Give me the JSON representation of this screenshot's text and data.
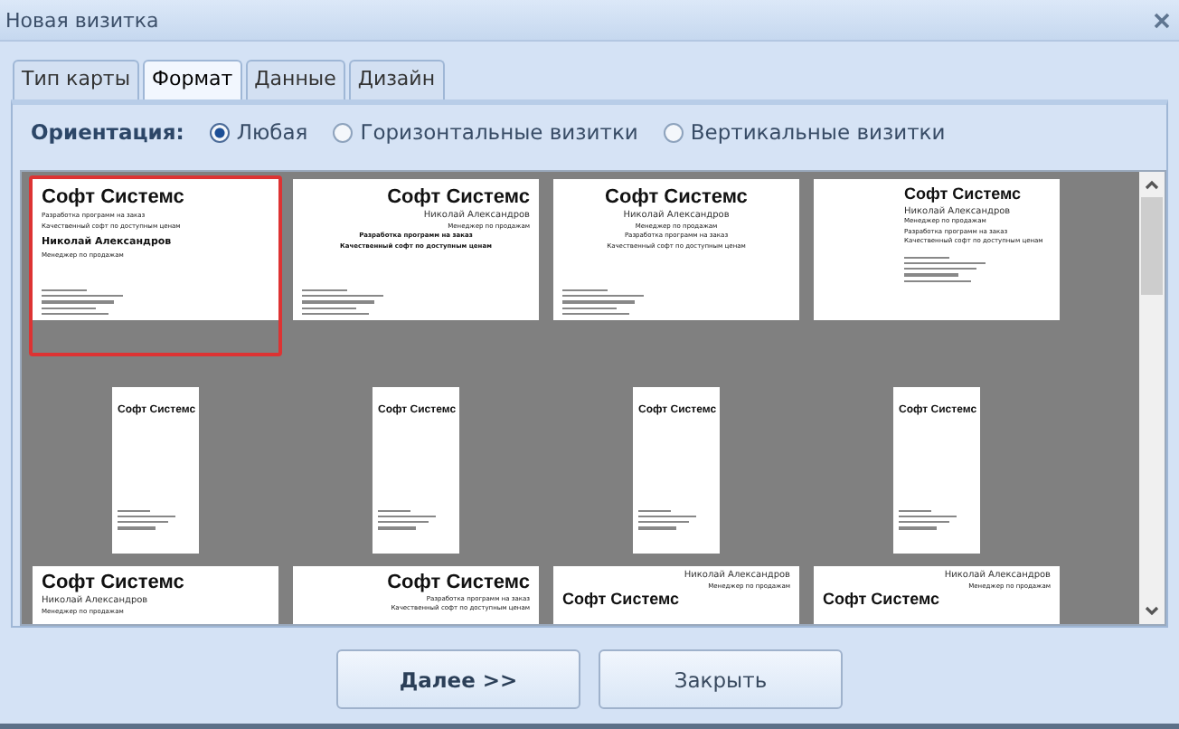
{
  "window": {
    "title": "Новая визитка"
  },
  "tabs": [
    {
      "label": "Тип карты",
      "selected": false
    },
    {
      "label": "Формат",
      "selected": true
    },
    {
      "label": "Данные",
      "selected": false
    },
    {
      "label": "Дизайн",
      "selected": false
    }
  ],
  "orientation": {
    "label": "Ориентация:",
    "options": [
      {
        "label": "Любая",
        "selected": true
      },
      {
        "label": "Горизонтальные визитки",
        "selected": false
      },
      {
        "label": "Вертикальные визитки",
        "selected": false
      }
    ]
  },
  "cards": [
    {
      "kind": "left",
      "selected": true,
      "lines": [
        {
          "kind": "company",
          "text": "Софт Системс"
        },
        {
          "kind": "slogan",
          "text": "Разработка программ на заказ"
        },
        {
          "kind": "slogan",
          "text": "Качественный софт по доступным ценам"
        },
        {
          "kind": "person",
          "text": "Николай Александров"
        },
        {
          "kind": "role",
          "text": "Менеджер по продажам"
        }
      ]
    },
    {
      "kind": "right",
      "selected": false,
      "lines": [
        {
          "kind": "company",
          "text": "Софт Системс"
        },
        {
          "kind": "person-light",
          "text": "Николай Александров"
        },
        {
          "kind": "role",
          "text": "Менеджер по продажам"
        },
        {
          "kind": "slogan-center",
          "text": "Разработка программ на заказ"
        },
        {
          "kind": "slogan-center",
          "text": "Качественный софт по доступным ценам"
        }
      ]
    },
    {
      "kind": "center",
      "selected": false,
      "lines": [
        {
          "kind": "company",
          "text": "Софт Системс"
        },
        {
          "kind": "person-light",
          "text": "Николай Александров"
        },
        {
          "kind": "role",
          "text": "Менеджер по продажам"
        },
        {
          "kind": "slogan",
          "text": "Разработка программ на заказ"
        },
        {
          "kind": "slogan",
          "text": "Качественный софт по доступным ценам"
        }
      ]
    },
    {
      "kind": "indent",
      "selected": false,
      "lines": [
        {
          "kind": "company",
          "text": "Софт Системс"
        },
        {
          "kind": "person-light",
          "text": "Николай Александров"
        },
        {
          "kind": "role",
          "text": "Менеджер по продажам"
        },
        {
          "kind": "slogan",
          "text": "Разработка программ на заказ"
        },
        {
          "kind": "slogan",
          "text": "Качественный софт по доступным ценам"
        }
      ]
    },
    {
      "kind": "vertical",
      "selected": false,
      "lines": [
        {
          "kind": "company",
          "text": "Софт Системс"
        }
      ]
    },
    {
      "kind": "vertical",
      "selected": false,
      "lines": [
        {
          "kind": "company",
          "text": "Софт Системс"
        }
      ]
    },
    {
      "kind": "vertical",
      "selected": false,
      "lines": [
        {
          "kind": "company",
          "text": "Софт Системс"
        }
      ]
    },
    {
      "kind": "vertical",
      "selected": false,
      "lines": [
        {
          "kind": "company",
          "text": "Софт Системс"
        }
      ]
    },
    {
      "kind": "cut",
      "selected": false,
      "lines": [
        {
          "kind": "company",
          "text": "Софт Системс"
        },
        {
          "kind": "person-light",
          "text": "Николай Александров"
        },
        {
          "kind": "role",
          "text": "Менеджер по продажам"
        }
      ]
    },
    {
      "kind": "cut-right",
      "selected": false,
      "lines": [
        {
          "kind": "company",
          "text": "Софт Системс"
        },
        {
          "kind": "role",
          "text": "Разработка программ на заказ"
        },
        {
          "kind": "role",
          "text": "Качественный софт по доступным ценам"
        }
      ]
    },
    {
      "kind": "split",
      "selected": false,
      "lines": [
        {
          "kind": "person-right",
          "text": "Николай Александров"
        },
        {
          "kind": "role-right",
          "text": "Менеджер по продажам"
        },
        {
          "kind": "company-mid",
          "text": "Софт Системс"
        }
      ]
    },
    {
      "kind": "split",
      "selected": false,
      "lines": [
        {
          "kind": "person-right",
          "text": "Николай Александров"
        },
        {
          "kind": "role-right",
          "text": "Менеджер по продажам"
        },
        {
          "kind": "company-mid",
          "text": "Софт Системс"
        }
      ]
    }
  ],
  "buttons": [
    {
      "label": "Далее >>",
      "kind": "primary"
    },
    {
      "label": "Закрыть",
      "kind": "secondary"
    }
  ]
}
